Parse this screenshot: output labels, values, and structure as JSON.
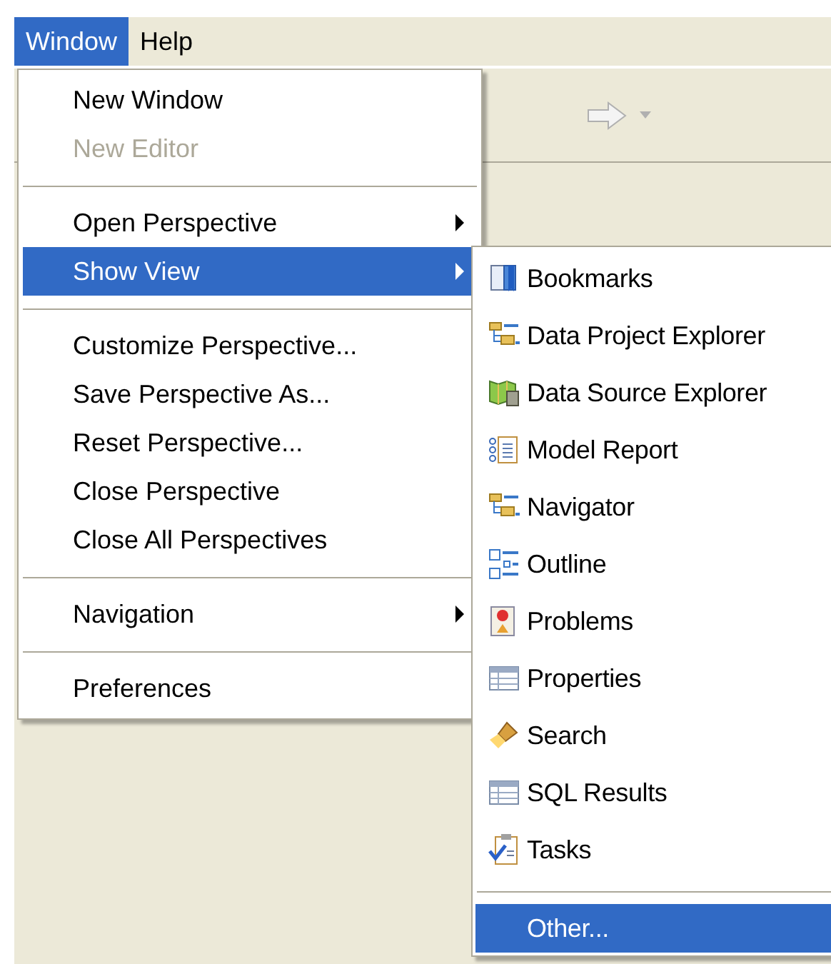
{
  "menu_bar": [
    {
      "label": "Window",
      "selected": true
    },
    {
      "label": "Help",
      "selected": false
    }
  ],
  "window_menu": {
    "items": [
      {
        "kind": "item",
        "label": "New Window",
        "disabled": false,
        "selected": false,
        "submenu": false
      },
      {
        "kind": "item",
        "label": "New Editor",
        "disabled": true,
        "selected": false,
        "submenu": false
      },
      {
        "kind": "separator"
      },
      {
        "kind": "item",
        "label": "Open Perspective",
        "disabled": false,
        "selected": false,
        "submenu": true
      },
      {
        "kind": "item",
        "label": "Show View",
        "disabled": false,
        "selected": true,
        "submenu": true
      },
      {
        "kind": "separator"
      },
      {
        "kind": "item",
        "label": "Customize Perspective...",
        "disabled": false,
        "selected": false,
        "submenu": false
      },
      {
        "kind": "item",
        "label": "Save Perspective As...",
        "disabled": false,
        "selected": false,
        "submenu": false
      },
      {
        "kind": "item",
        "label": "Reset Perspective...",
        "disabled": false,
        "selected": false,
        "submenu": false
      },
      {
        "kind": "item",
        "label": "Close Perspective",
        "disabled": false,
        "selected": false,
        "submenu": false
      },
      {
        "kind": "item",
        "label": "Close All Perspectives",
        "disabled": false,
        "selected": false,
        "submenu": false
      },
      {
        "kind": "separator"
      },
      {
        "kind": "item",
        "label": "Navigation",
        "disabled": false,
        "selected": false,
        "submenu": true
      },
      {
        "kind": "separator"
      },
      {
        "kind": "item",
        "label": "Preferences",
        "disabled": false,
        "selected": false,
        "submenu": false
      }
    ]
  },
  "show_view_submenu": {
    "items": [
      {
        "kind": "item",
        "label": "Bookmarks",
        "selected": false
      },
      {
        "kind": "item",
        "label": "Data Project Explorer",
        "selected": false
      },
      {
        "kind": "item",
        "label": "Data Source Explorer",
        "selected": false
      },
      {
        "kind": "item",
        "label": "Model Report",
        "selected": false
      },
      {
        "kind": "item",
        "label": "Navigator",
        "selected": false
      },
      {
        "kind": "item",
        "label": "Outline",
        "selected": false
      },
      {
        "kind": "item",
        "label": "Problems",
        "selected": false
      },
      {
        "kind": "item",
        "label": "Properties",
        "selected": false
      },
      {
        "kind": "item",
        "label": "Search",
        "selected": false
      },
      {
        "kind": "item",
        "label": "SQL Results",
        "selected": false
      },
      {
        "kind": "item",
        "label": "Tasks",
        "selected": false
      },
      {
        "kind": "separator"
      },
      {
        "kind": "item",
        "label": "Other...",
        "selected": true
      }
    ]
  }
}
